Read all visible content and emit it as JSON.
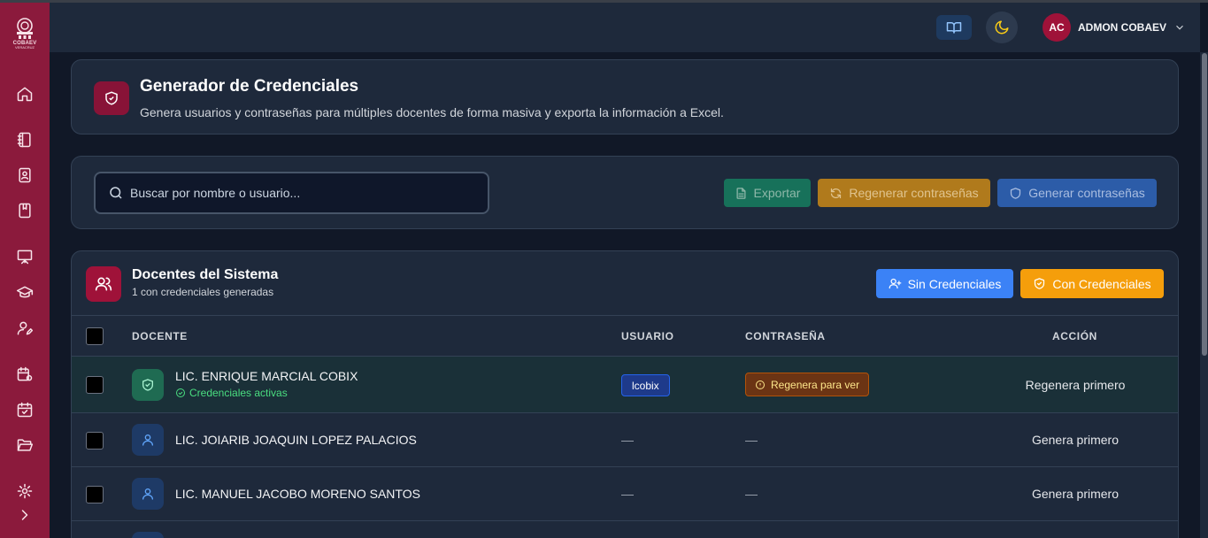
{
  "logo": {
    "text": "COBAEV",
    "sub": "VERACRUZ"
  },
  "sidebar": {
    "items": [
      {
        "icon": "home-icon"
      },
      {
        "icon": "notebook-icon"
      },
      {
        "icon": "contact-book-icon"
      },
      {
        "icon": "bookmark-book-icon"
      },
      {
        "icon": "presentation-icon"
      },
      {
        "icon": "graduation-cap-icon"
      },
      {
        "icon": "user-edit-icon"
      },
      {
        "icon": "calendar-settings-icon"
      },
      {
        "icon": "calendar-check-icon"
      },
      {
        "icon": "folder-open-icon"
      },
      {
        "icon": "settings-icon"
      }
    ],
    "expand_icon": "chevron-right-icon"
  },
  "header": {
    "user_initials": "AC",
    "user_name": "ADMON COBAEV"
  },
  "page": {
    "title": "Generador de Credenciales",
    "subtitle": "Genera usuarios y contraseñas para múltiples docentes de forma masiva y exporta la información a Excel."
  },
  "toolbar": {
    "search_placeholder": "Buscar por nombre o usuario...",
    "search_value": "",
    "export_label": "Exportar",
    "regen_label": "Regenerar contraseñas",
    "generate_label": "Generar contraseñas"
  },
  "table": {
    "title": "Docentes del Sistema",
    "subtitle": "1 con credenciales generadas",
    "filter_without": "Sin Credenciales",
    "filter_with": "Con Credenciales",
    "columns": [
      "DOCENTE",
      "USUARIO",
      "CONTRASEÑA",
      "ACCIÓN"
    ],
    "rows": [
      {
        "name": "LIC. ENRIQUE MARCIAL COBIX",
        "status": "Credenciales activas",
        "user": "lcobix",
        "password": "Regenera para ver",
        "action": "Regenera primero"
      },
      {
        "name": "LIC. JOIARIB JOAQUIN LOPEZ PALACIOS",
        "user": "—",
        "password": "—",
        "action": "Genera primero"
      },
      {
        "name": "LIC. MANUEL JACOBO MORENO SANTOS",
        "user": "—",
        "password": "—",
        "action": "Genera primero"
      }
    ]
  }
}
